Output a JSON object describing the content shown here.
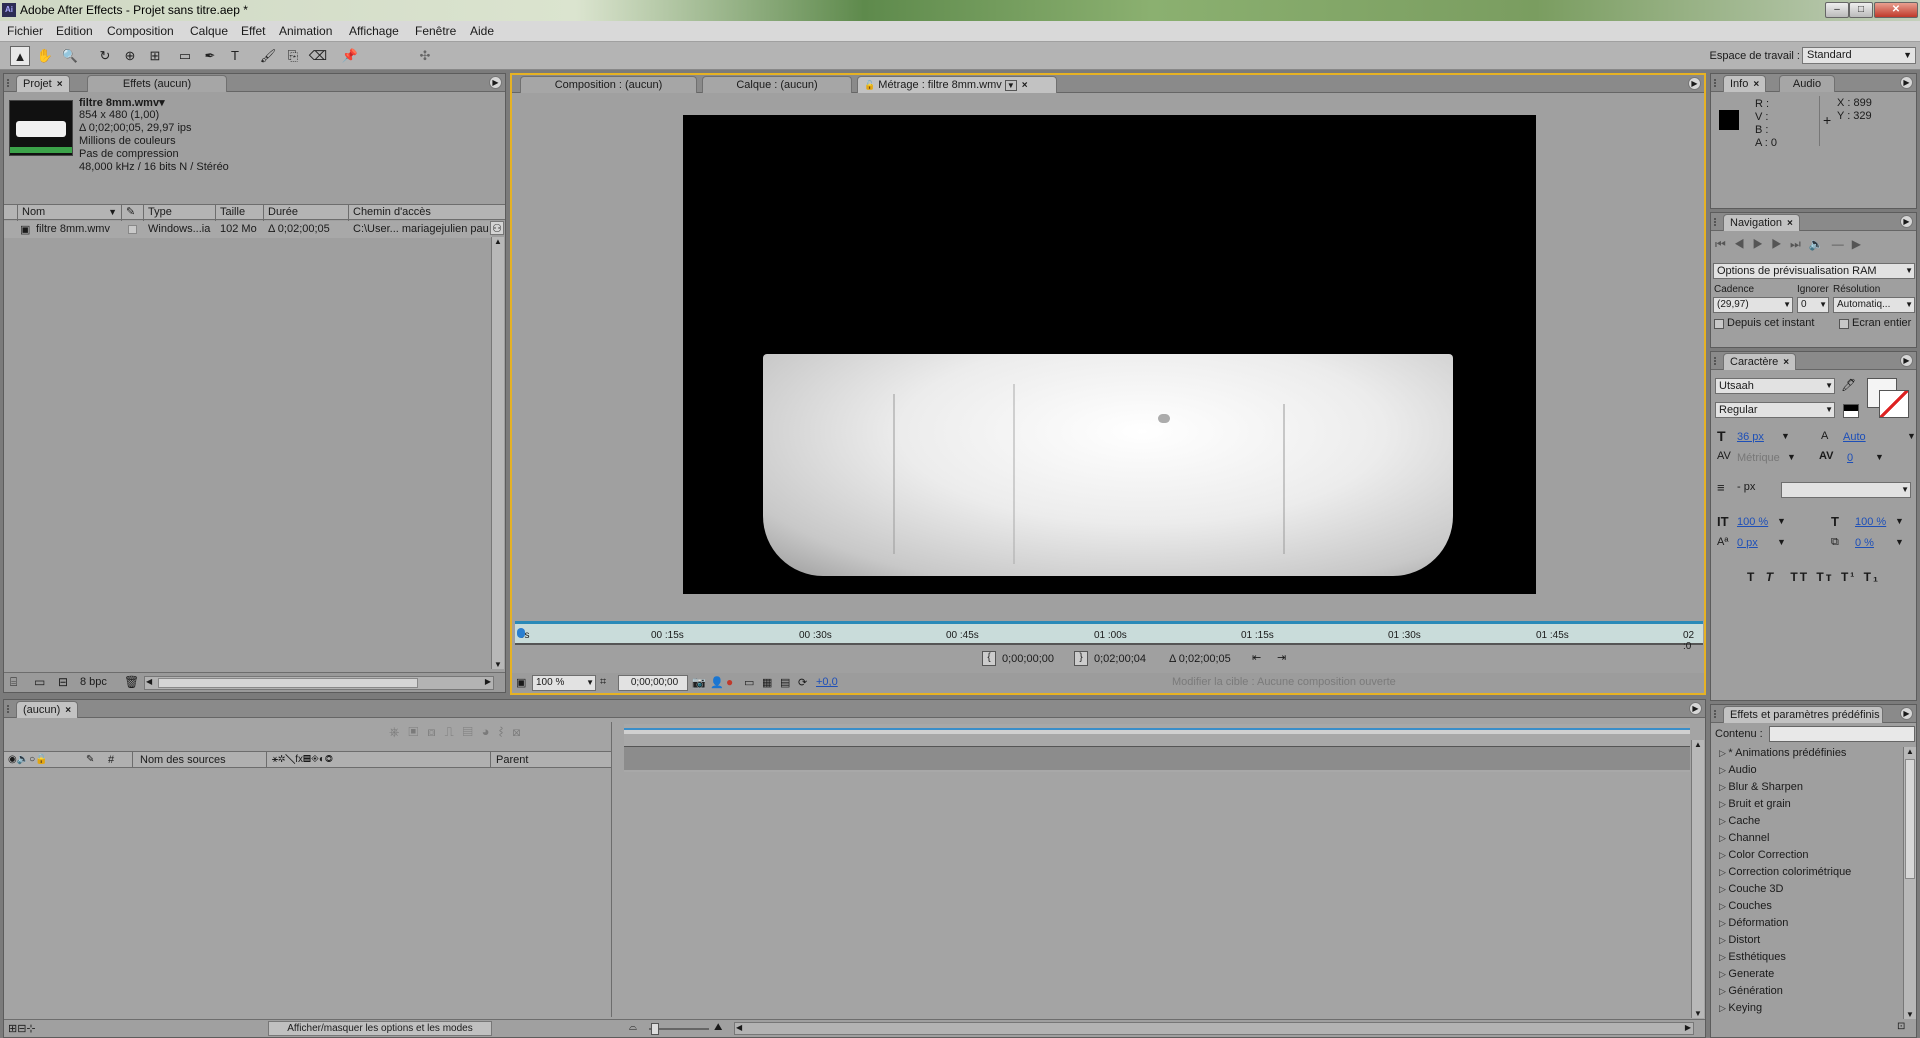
{
  "app": {
    "logo": "Ai",
    "title": "Adobe After Effects - Projet sans titre.aep *",
    "window_buttons": [
      "–",
      "□",
      "✕"
    ]
  },
  "menu": [
    "Fichier",
    "Edition",
    "Composition",
    "Calque",
    "Effet",
    "Animation",
    "Affichage",
    "Fenêtre",
    "Aide"
  ],
  "toolbar": {
    "tools": [
      {
        "name": "selection-tool-icon",
        "glyph": "▲"
      },
      {
        "name": "hand-tool-icon",
        "glyph": "✋"
      },
      {
        "name": "zoom-tool-icon",
        "glyph": "🔍"
      },
      {
        "name": "rotate-tool-icon",
        "glyph": "↻"
      },
      {
        "name": "camera-orbit-tool-icon",
        "glyph": "⊕"
      },
      {
        "name": "pan-behind-tool-icon",
        "glyph": "⊞"
      },
      {
        "name": "rectangle-mask-tool-icon",
        "glyph": "▭"
      },
      {
        "name": "pen-tool-icon",
        "glyph": "✒"
      },
      {
        "name": "text-tool-icon",
        "glyph": "T"
      },
      {
        "name": "brush-tool-icon",
        "glyph": "🖌"
      },
      {
        "name": "clone-stamp-tool-icon",
        "glyph": "⎘"
      },
      {
        "name": "eraser-tool-icon",
        "glyph": "⌫"
      },
      {
        "name": "puppet-pin-tool-icon",
        "glyph": "📌"
      },
      {
        "name": "axis-mode-icon",
        "glyph": "✣"
      }
    ],
    "workspace_label": "Espace de travail :",
    "workspace_value": "Standard"
  },
  "project": {
    "tabs": [
      "Projet",
      "Effets (aucun)"
    ],
    "footage_name": "filtre 8mm.wmv▾",
    "footage_info": [
      "854 x 480 (1,00)",
      "Δ 0;02;00;05, 29,97 ips",
      "Millions de couleurs",
      "Pas de compression",
      "48,000 kHz / 16 bits N / Stéréo"
    ],
    "columns": [
      "Nom",
      "Type",
      "Taille",
      "Durée",
      "Chemin d'accès"
    ],
    "rows": [
      {
        "name": "filtre 8mm.wmv",
        "type": "Windows...ia",
        "size": "102 Mo",
        "duration": "Δ 0;02;00;05",
        "path": "C:\\User... mariagejulien pau"
      }
    ],
    "bpc": "8 bpc"
  },
  "viewer": {
    "tabs": [
      "Composition : (aucun)",
      "Calque : (aucun)",
      "Métrage : filtre 8mm.wmv"
    ],
    "ruler": [
      "0s",
      "00 :15s",
      "00 :30s",
      "00 :45s",
      "01 :00s",
      "01 :15s",
      "01 :30s",
      "01 :45s",
      "02 :0"
    ],
    "in_point": "0;00;00;00",
    "out_point": "0;02;00;04",
    "duration": "Δ 0;02;00;05",
    "zoom": "100 %",
    "timecode": "0;00;00;00",
    "exposure": "+0,0",
    "target": "Modifier la cible : Aucune composition ouverte"
  },
  "info": {
    "tabs": [
      "Info",
      "Audio"
    ],
    "r": "R :",
    "v": "V :",
    "b": "B :",
    "a": "A : 0",
    "x": "X : 899",
    "y": "Y : 329"
  },
  "navigation": {
    "tab": "Navigation",
    "ram_options": "Options de prévisualisation RAM",
    "cadence_label": "Cadence",
    "ignore_label": "Ignorer",
    "resolution_label": "Résolution",
    "cadence_value": "(29,97)",
    "ignore_value": "0",
    "resolution_value": "Automatiq...",
    "from_current": "Depuis cet instant",
    "full_screen": "Ecran entier"
  },
  "character": {
    "tab": "Caractère",
    "font": "Utsaah",
    "style": "Regular",
    "size": "36 px",
    "leading": "Auto",
    "kerning": "Métrique",
    "tracking": "0",
    "stroke": "- px",
    "vscale": "100 %",
    "hscale": "100 %",
    "baseline": "0 px",
    "tsume": "0 %",
    "styles": [
      "T",
      "T",
      "TT",
      "Tт",
      "T¹",
      "T₁"
    ]
  },
  "effects": {
    "tab": "Effets et paramètres prédéfinis",
    "search_label": "Contenu :",
    "search_value": "",
    "items": [
      "* Animations prédéfinies",
      "Audio",
      "Blur & Sharpen",
      "Bruit et grain",
      "Cache",
      "Channel",
      "Color Correction",
      "Correction colorimétrique",
      "Couche 3D",
      "Couches",
      "Déformation",
      "Distort",
      "Esthétiques",
      "Generate",
      "Génération",
      "Keying"
    ]
  },
  "timeline": {
    "tab": "(aucun)",
    "col_num": "#",
    "col_source": "Nom des sources",
    "col_parent": "Parent",
    "toggle_modes": "Afficher/masquer les options et les modes"
  }
}
